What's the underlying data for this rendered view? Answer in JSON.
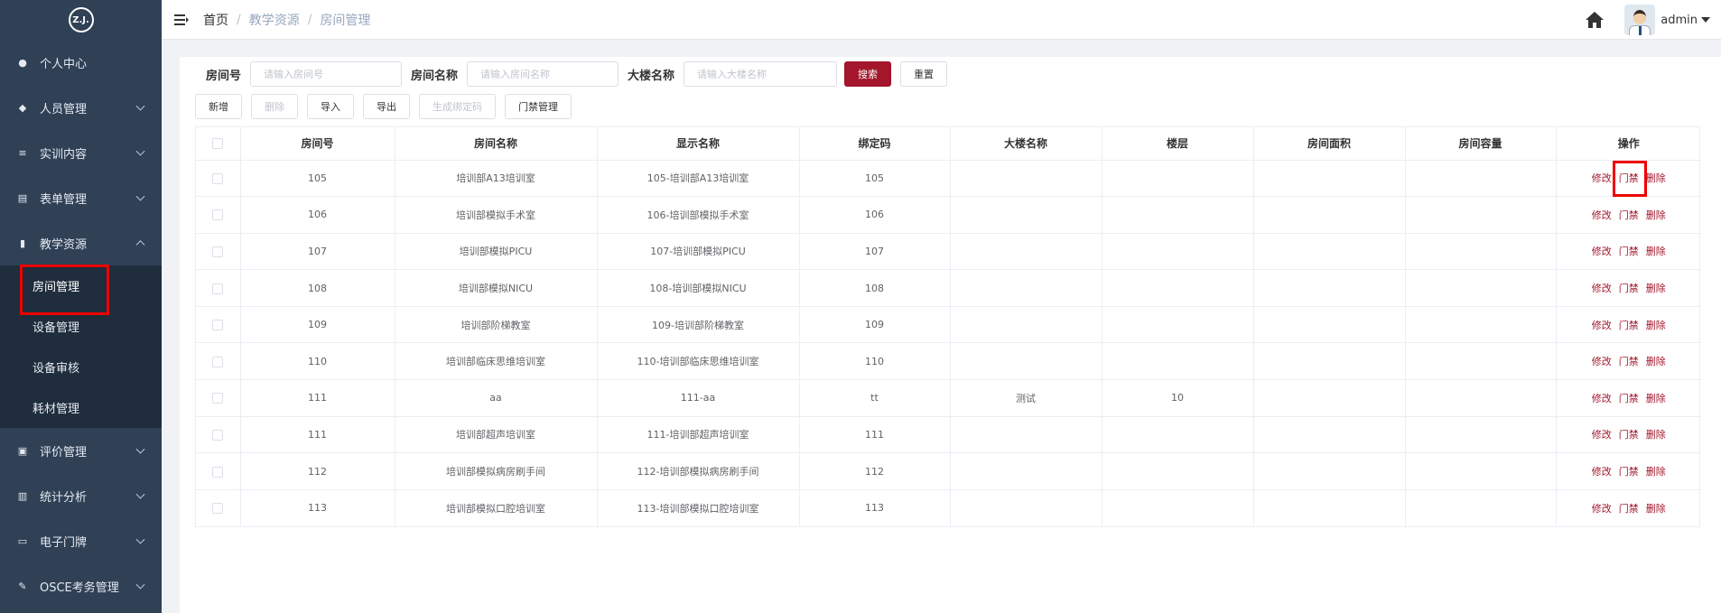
{
  "logo": {
    "text": "ZJL"
  },
  "sidebar": {
    "items": [
      {
        "label": "个人中心",
        "icon": "user-icon",
        "chevron": false
      },
      {
        "label": "人员管理",
        "icon": "users-icon",
        "chevron": true
      },
      {
        "label": "实训内容",
        "icon": "tree-icon",
        "chevron": true
      },
      {
        "label": "表单管理",
        "icon": "form-icon",
        "chevron": true
      },
      {
        "label": "教学资源",
        "icon": "book-icon",
        "chevron": true,
        "expanded": true
      },
      {
        "label": "评价管理",
        "icon": "rating-icon",
        "chevron": true
      },
      {
        "label": "统计分析",
        "icon": "bar-chart-icon",
        "chevron": true
      },
      {
        "label": "电子门牌",
        "icon": "display-icon",
        "chevron": true
      },
      {
        "label": "OSCE考务管理",
        "icon": "edit-icon",
        "chevron": true
      }
    ],
    "submenu": [
      {
        "label": "房间管理",
        "active": true
      },
      {
        "label": "设备管理"
      },
      {
        "label": "设备审核"
      },
      {
        "label": "耗材管理"
      }
    ]
  },
  "header": {
    "breadcrumb": [
      "首页",
      "教学资源",
      "房间管理"
    ],
    "separator": "/",
    "user": "admin"
  },
  "filters": {
    "room_no": {
      "label": "房间号",
      "placeholder": "请输入房间号"
    },
    "room_name": {
      "label": "房间名称",
      "placeholder": "请输入房间名称"
    },
    "building": {
      "label": "大楼名称",
      "placeholder": "请输入大楼名称"
    },
    "search_label": "搜索",
    "reset_label": "重置"
  },
  "toolbar": {
    "add": "新增",
    "delete": "删除",
    "import": "导入",
    "export": "导出",
    "gen_code": "生成绑定码",
    "access": "门禁管理"
  },
  "table": {
    "columns": [
      "房间号",
      "房间名称",
      "显示名称",
      "绑定码",
      "大楼名称",
      "楼层",
      "房间面积",
      "房间容量",
      "操作"
    ],
    "actions": [
      "修改",
      "门禁",
      "删除"
    ],
    "rows": [
      [
        "105",
        "培训部A13培训室",
        "105-培训部A13培训室",
        "105",
        "",
        "",
        "",
        ""
      ],
      [
        "106",
        "培训部模拟手术室",
        "106-培训部模拟手术室",
        "106",
        "",
        "",
        "",
        ""
      ],
      [
        "107",
        "培训部模拟PICU",
        "107-培训部模拟PICU",
        "107",
        "",
        "",
        "",
        ""
      ],
      [
        "108",
        "培训部模拟NICU",
        "108-培训部模拟NICU",
        "108",
        "",
        "",
        "",
        ""
      ],
      [
        "109",
        "培训部阶梯教室",
        "109-培训部阶梯教室",
        "109",
        "",
        "",
        "",
        ""
      ],
      [
        "110",
        "培训部临床思维培训室",
        "110-培训部临床思维培训室",
        "110",
        "",
        "",
        "",
        ""
      ],
      [
        "111",
        "aa",
        "111-aa",
        "tt",
        "测试",
        "10",
        "",
        ""
      ],
      [
        "111",
        "培训部超声培训室",
        "111-培训部超声培训室",
        "111",
        "",
        "",
        "",
        ""
      ],
      [
        "112",
        "培训部模拟病房刷手间",
        "112-培训部模拟病房刷手间",
        "112",
        "",
        "",
        "",
        ""
      ],
      [
        "113",
        "培训部模拟口腔培训室",
        "113-培训部模拟口腔培训室",
        "113",
        "",
        "",
        "",
        ""
      ]
    ]
  },
  "colors": {
    "sidebar_bg": "#304156",
    "submenu_bg": "#1f2d3d",
    "accent": "#a3162b",
    "highlight": "#e00000"
  }
}
